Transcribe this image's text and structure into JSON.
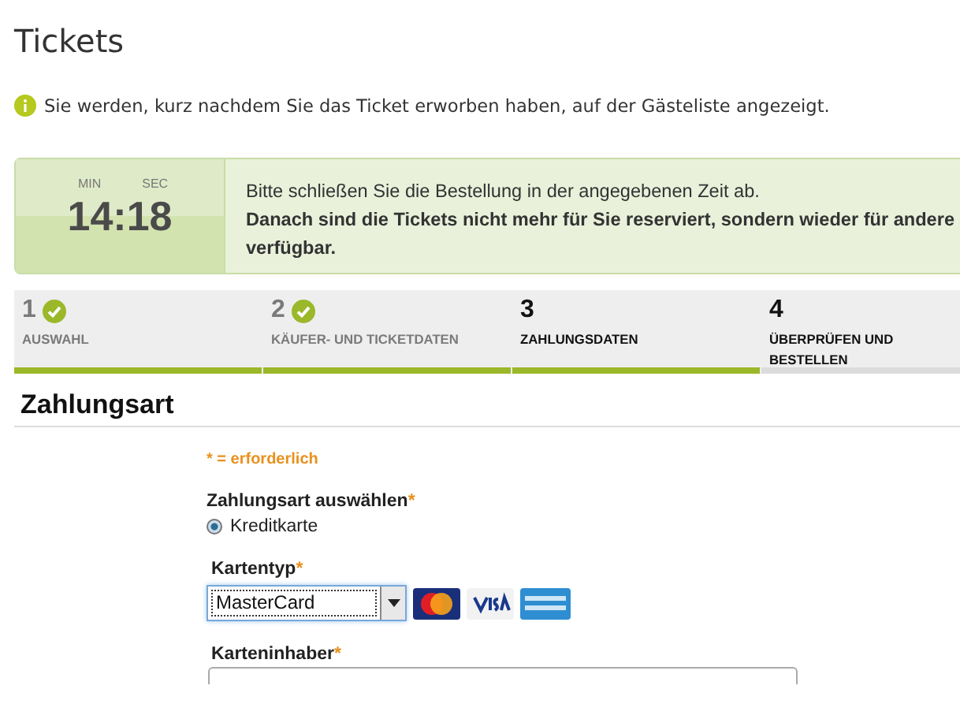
{
  "page_title": "Tickets",
  "info": "Sie werden, kurz nachdem Sie das Ticket erworben haben, auf der Gästeliste angezeigt.",
  "timer": {
    "min_label": "MIN",
    "sec_label": "SEC",
    "time": "14:18",
    "message": "Bitte schließen Sie die Bestellung in der angegebenen Zeit ab.",
    "warning": "Danach sind die Tickets nicht mehr für Sie reserviert, sondern wieder für andere verfügbar."
  },
  "steps": [
    {
      "number": "1",
      "label": "AUSWAHL",
      "done": true,
      "selected": false
    },
    {
      "number": "2",
      "label": "KÄUFER- UND TICKETDATEN",
      "done": true,
      "selected": false
    },
    {
      "number": "3",
      "label": "ZAHLUNGSDATEN",
      "done": false,
      "selected": true
    },
    {
      "number": "4",
      "label": "ÜBERPRÜFEN UND BESTELLEN",
      "done": false,
      "selected": false
    }
  ],
  "section_title": "Zahlungsart",
  "required_note": "* = erforderlich",
  "payment_method": {
    "label": "Zahlungsart auswählen",
    "required_mark": "*",
    "options": [
      {
        "label": "Kreditkarte",
        "selected": true
      }
    ]
  },
  "card_type": {
    "label": "Kartentyp",
    "required_mark": "*",
    "value": "MasterCard"
  },
  "card_holder": {
    "label": "Karteninhaber",
    "required_mark": "*"
  }
}
